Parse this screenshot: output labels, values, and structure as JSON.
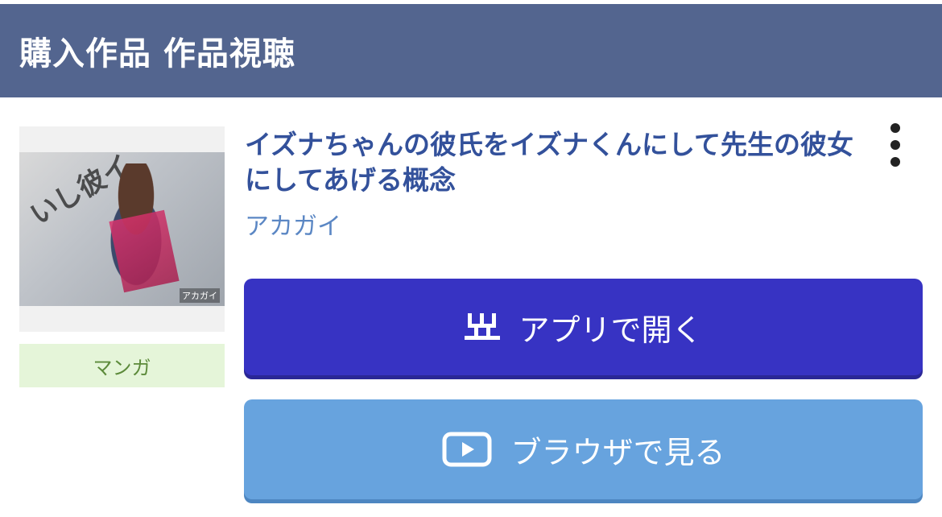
{
  "header": {
    "title": "購入作品 作品視聴"
  },
  "work": {
    "cover_text": "いし彼イ",
    "cover_author": "アカガイ",
    "genre": "マンガ",
    "title": "イズナちゃんの彼氏をイズナくんにして先生の彼女にしてあげる概念",
    "author": "アカガイ"
  },
  "actions": {
    "app_label": "アプリで開く",
    "browser_label": "ブラウザで見る"
  },
  "icons": {
    "menu": "more-vertical-icon",
    "app": "app-logo-icon",
    "browser": "play-icon"
  },
  "colors": {
    "header_bg": "#53658f",
    "title": "#33519b",
    "author": "#5b87c4",
    "app_button": "#3733c3",
    "browser_button": "#67a3de",
    "genre_bg": "#e5f5d9",
    "genre_text": "#5c8a3a"
  }
}
